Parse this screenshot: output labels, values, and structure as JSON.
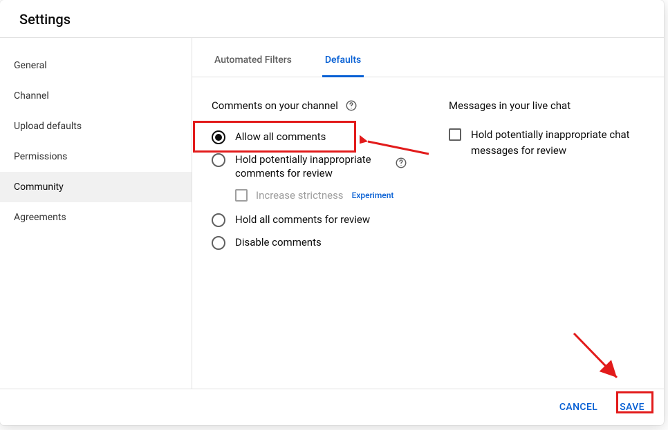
{
  "header": {
    "title": "Settings"
  },
  "sidebar": {
    "items": [
      {
        "label": "General"
      },
      {
        "label": "Channel"
      },
      {
        "label": "Upload defaults"
      },
      {
        "label": "Permissions"
      },
      {
        "label": "Community"
      },
      {
        "label": "Agreements"
      }
    ],
    "active_index": 4
  },
  "tabs": {
    "items": [
      {
        "label": "Automated Filters"
      },
      {
        "label": "Defaults"
      }
    ],
    "active_index": 1
  },
  "comments_section": {
    "title": "Comments on your channel",
    "options": [
      {
        "label": "Allow all comments"
      },
      {
        "label": "Hold potentially inappropriate comments for review"
      },
      {
        "label": "Hold all comments for review"
      },
      {
        "label": "Disable comments"
      }
    ],
    "selected_index": 0,
    "sub_option": {
      "label": "Increase strictness",
      "badge": "Experiment",
      "checked": false
    }
  },
  "livechat_section": {
    "title": "Messages in your live chat",
    "option": {
      "label": "Hold potentially inappropriate chat messages for review",
      "checked": false
    }
  },
  "footer": {
    "cancel": "CANCEL",
    "save": "SAVE"
  }
}
